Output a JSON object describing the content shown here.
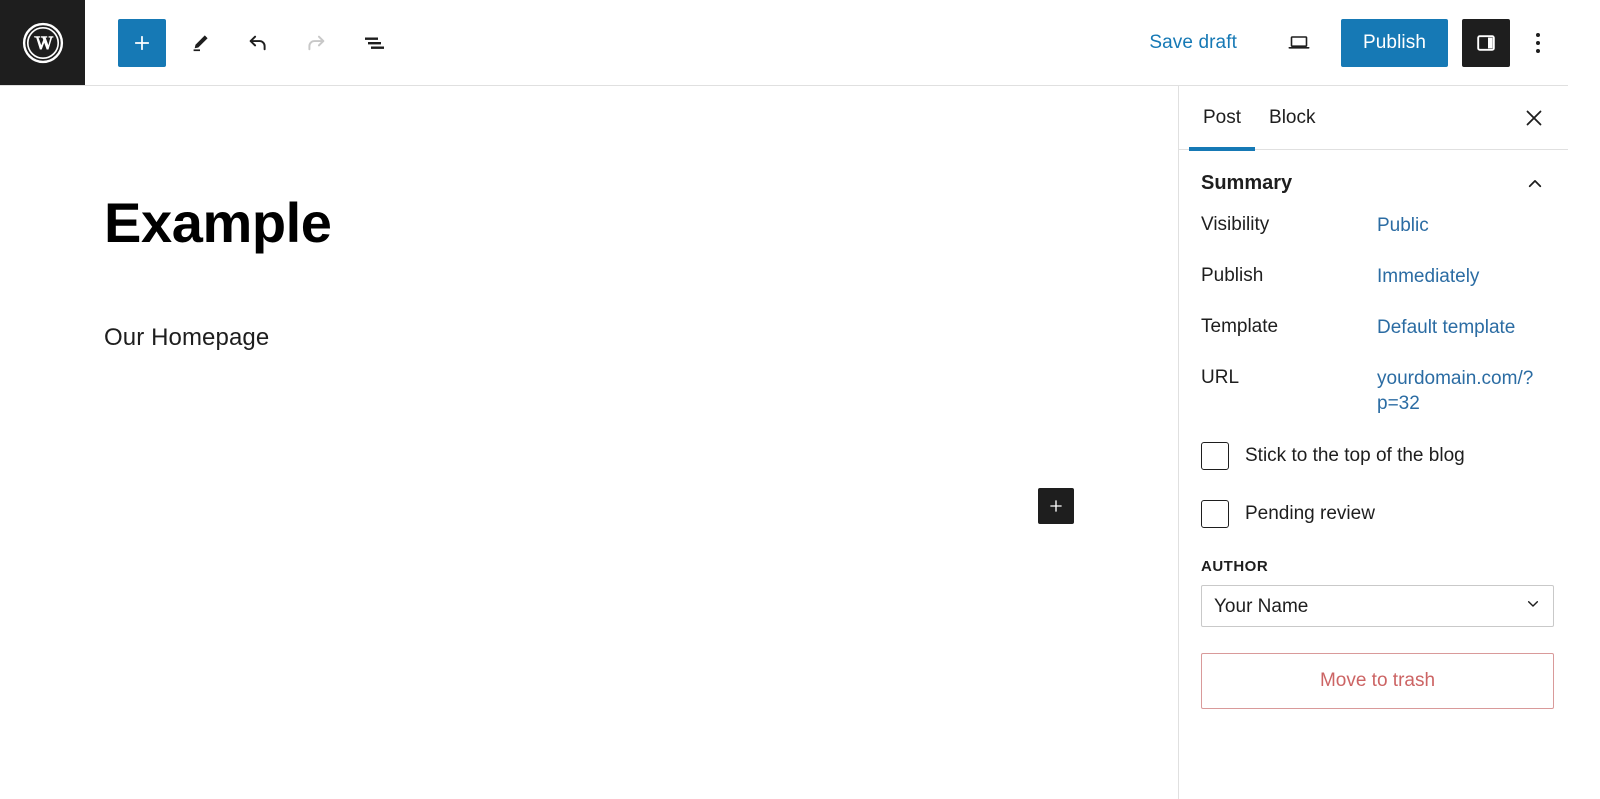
{
  "app": {
    "name": "WordPress Block Editor",
    "logo_icon": "wordpress-logo-icon"
  },
  "toolbar": {
    "add_block_label": "+",
    "add_block_icon": "plus-icon",
    "tools_icon": "pencil-edit-icon",
    "undo_icon": "undo-arrow-icon",
    "redo_icon": "redo-arrow-icon",
    "list_view_icon": "list-view-icon",
    "save_draft_label": "Save draft",
    "preview_icon": "laptop-preview-icon",
    "publish_label": "Publish",
    "settings_toggle_icon": "sidebar-panel-icon",
    "more_menu_icon": "three-dots-vertical-icon",
    "accent_blue": "#1679b5",
    "dark": "#1e1e1e"
  },
  "editor": {
    "post_title": "Example",
    "paragraph": "Our Homepage",
    "block_appender_label": "+",
    "block_appender_icon": "plus-icon"
  },
  "sidebar": {
    "tabs": [
      {
        "label": "Post",
        "active": true
      },
      {
        "label": "Block",
        "active": false
      }
    ],
    "close_icon": "close-x-icon",
    "panel": {
      "title": "Summary",
      "collapse_icon": "chevron-up-icon",
      "rows": [
        {
          "label": "Visibility",
          "value": "Public"
        },
        {
          "label": "Publish",
          "value": "Immediately"
        },
        {
          "label": "Template",
          "value": "Default template"
        },
        {
          "label": "URL",
          "value": "yourdomain.com/?p=32"
        }
      ],
      "checkboxes": [
        {
          "label": "Stick to the top of the blog",
          "checked": false
        },
        {
          "label": "Pending review",
          "checked": false
        }
      ],
      "author_label": "AUTHOR",
      "author_value": "Your Name",
      "author_chevron_icon": "chevron-down-icon",
      "trash_label": "Move to trash",
      "link_color": "#2b6ca3",
      "danger_color": "#cc6464"
    }
  }
}
